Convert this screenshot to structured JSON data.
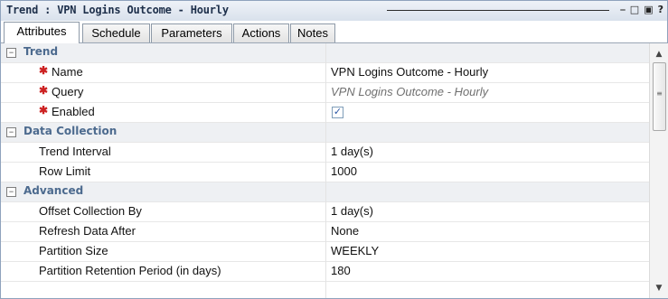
{
  "window": {
    "title": "Trend : VPN Logins Outcome - Hourly",
    "buttons": {
      "minimize": "⎯",
      "restore": "□",
      "maximize": "▣",
      "help": "?"
    }
  },
  "tabs": [
    {
      "label": "Attributes"
    },
    {
      "label": "Schedule"
    },
    {
      "label": "Parameters"
    },
    {
      "label": "Actions"
    },
    {
      "label": "Notes"
    }
  ],
  "sections": {
    "trend": {
      "label": "Trend",
      "expander": "−",
      "rows": [
        {
          "label": "Name",
          "value": "VPN Logins Outcome - Hourly",
          "required": true
        },
        {
          "label": "Query",
          "value": "VPN Logins Outcome - Hourly",
          "required": true
        },
        {
          "label": "Enabled",
          "checkbox": "✓",
          "required": true
        }
      ]
    },
    "data_collection": {
      "label": "Data Collection",
      "expander": "−",
      "rows": [
        {
          "label": "Trend Interval",
          "value": "1 day(s)"
        },
        {
          "label": "Row Limit",
          "value": "1000"
        }
      ]
    },
    "advanced": {
      "label": "Advanced",
      "expander": "−",
      "rows": [
        {
          "label": "Offset Collection By",
          "value": "1 day(s)"
        },
        {
          "label": "Refresh Data After",
          "value": "None"
        },
        {
          "label": "Partition Size",
          "value": "WEEKLY"
        },
        {
          "label": "Partition Retention Period (in days)",
          "value": "180"
        }
      ]
    }
  },
  "required_marker": "✱",
  "scrollbar": {
    "up_arrow": "▲",
    "down_arrow": "▼",
    "grip": "≡"
  },
  "colors": {
    "section_label": "#4c6a8e",
    "required": "#cc2222",
    "title": "#1d2f4a"
  }
}
